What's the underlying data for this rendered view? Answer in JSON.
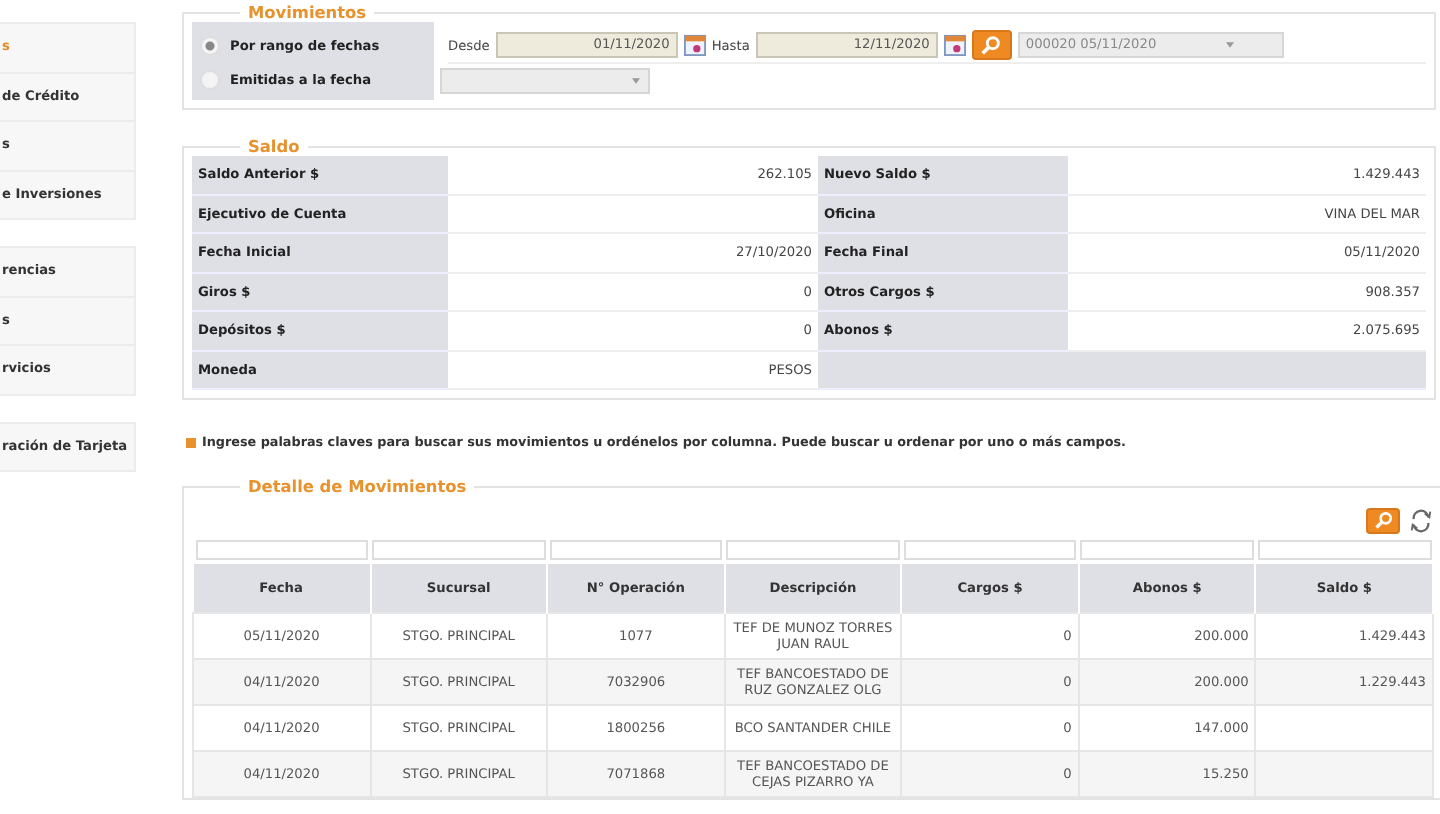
{
  "sidebar": {
    "groups": [
      {
        "items": [
          {
            "label": "s",
            "selected": true
          },
          {
            "label": "de Crédito",
            "selected": false
          },
          {
            "label": "s",
            "selected": false
          },
          {
            "label": "e Inversiones",
            "selected": false
          }
        ]
      },
      {
        "items": [
          {
            "label": "rencias",
            "selected": false
          },
          {
            "label": "s",
            "selected": false
          },
          {
            "label": "rvicios",
            "selected": false
          }
        ]
      },
      {
        "items": [
          {
            "label": "ración de Tarjeta",
            "selected": false
          }
        ]
      }
    ]
  },
  "movimientos": {
    "title": "Movimientos",
    "options": [
      {
        "label": "Por rango de fechas",
        "selected": true
      },
      {
        "label": "Emitidas a la fecha",
        "selected": false
      }
    ],
    "desde_label": "Desde",
    "desde": "01/11/2020",
    "hasta_label": "Hasta",
    "hasta": "12/11/2020",
    "cartola": "000020 05/11/2020"
  },
  "saldo": {
    "title": "Saldo",
    "rows": [
      {
        "label": "Saldo Anterior $",
        "value": "262.105",
        "label2": "Nuevo Saldo $",
        "value2": "1.429.443"
      },
      {
        "label": "Ejecutivo de Cuenta",
        "label2": "Oficina",
        "value2": "VINA DEL MAR"
      },
      {
        "label": "Fecha Inicial",
        "value": "27/10/2020",
        "label2": "Fecha Final",
        "value2": "05/11/2020"
      },
      {
        "label": "Giros $",
        "value": "0",
        "label2": "Otros Cargos $",
        "value2": "908.357"
      },
      {
        "label": "Depósitos $",
        "value": "0",
        "label2": "Abonos $",
        "value2": "2.075.695"
      },
      {
        "label": "Moneda",
        "value": "PESOS"
      }
    ]
  },
  "hint": "Ingrese palabras claves para buscar sus movimientos u ordénelos por columna. Puede buscar u ordenar por uno o más campos.",
  "detalle": {
    "title": "Detalle de Movimientos",
    "columns": [
      "Fecha",
      "Sucursal",
      "N° Operación",
      "Descripción",
      "Cargos $",
      "Abonos $",
      "Saldo $"
    ],
    "rows": [
      [
        "05/11/2020",
        "STGO. PRINCIPAL",
        "1077",
        "TEF DE MUNOZ TORRES JUAN RAUL",
        "0",
        "200.000",
        "1.429.443"
      ],
      [
        "04/11/2020",
        "STGO. PRINCIPAL",
        "7032906",
        "TEF BANCOESTADO DE RUZ GONZALEZ OLG",
        "0",
        "200.000",
        "1.229.443"
      ],
      [
        "04/11/2020",
        "STGO. PRINCIPAL",
        "1800256",
        "BCO SANTANDER CHILE",
        "0",
        "147.000",
        null
      ],
      [
        "04/11/2020",
        "STGO. PRINCIPAL",
        "7071868",
        "TEF BANCOESTADO DE CEJAS PIZARRO YA",
        "0",
        "15.250",
        null
      ]
    ]
  }
}
